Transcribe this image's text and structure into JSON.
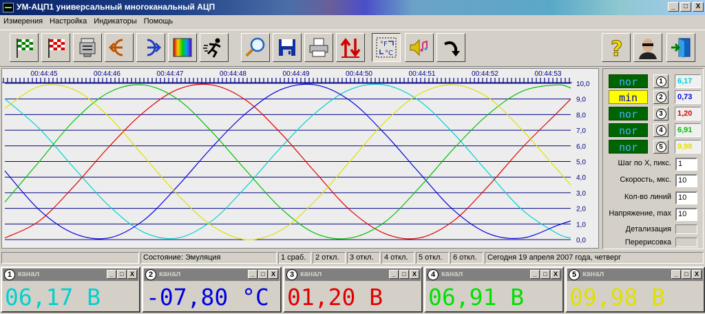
{
  "window": {
    "title": "УМ-АЦП1 универсальный многоканальный АЦП",
    "min_label": "_",
    "max_label": "□",
    "close_label": "X"
  },
  "menu": [
    "Измерения",
    "Настройка",
    "Индикаторы",
    "Помощь"
  ],
  "toolbar": {
    "icons": [
      "start-flag-icon",
      "stop-flag-icon",
      "device-icon",
      "input-icon",
      "output-icon",
      "spectrum-icon",
      "runner-icon",
      "magnifier-icon",
      "save-icon",
      "printer-icon",
      "sort-arrows-icon",
      "units-convert-icon",
      "sound-icon",
      "undo-arrow-icon",
      "help-icon",
      "user-icon",
      "exit-icon"
    ]
  },
  "chart_data": {
    "type": "line",
    "title": "",
    "xlabel": "",
    "ylabel": "",
    "x_ticks": [
      "00:44:45",
      "00:44:46",
      "00:44:47",
      "00:44:48",
      "00:44:49",
      "00:44:50",
      "00:44:51",
      "00:44:52",
      "00:44:53"
    ],
    "y_ticks": [
      "10,0",
      "9,0",
      "8,0",
      "7,0",
      "6,0",
      "5,0",
      "4,0",
      "3,0",
      "2,0",
      "1,0",
      "0,0"
    ],
    "ylim": [
      0,
      10
    ],
    "grid": true,
    "series": [
      {
        "color": "#00d0d0",
        "x": [
          0,
          0.5,
          1,
          1.5,
          2,
          2.5,
          3,
          3.5,
          4,
          4.5,
          5,
          5.5,
          6,
          6.5,
          7,
          7.5,
          8,
          8.2
        ],
        "values": [
          9.0,
          7.1,
          4.6,
          2.2,
          0.5,
          0.1,
          1.2,
          3.4,
          5.9,
          8.1,
          9.6,
          9.9,
          8.9,
          6.8,
          4.3,
          1.9,
          0.4,
          0.1
        ]
      },
      {
        "color": "#0000e0",
        "x": [
          0,
          0.5,
          1,
          1.5,
          2,
          2.5,
          3,
          3.5,
          4,
          4.5,
          5,
          5.5,
          6,
          6.5,
          7,
          7.5,
          8,
          8.2
        ],
        "values": [
          4.4,
          1.9,
          0.4,
          0.1,
          1.2,
          3.4,
          5.9,
          8.1,
          9.6,
          9.9,
          8.9,
          6.8,
          4.3,
          1.9,
          0.4,
          0.1,
          0.9,
          1.2
        ]
      },
      {
        "color": "#e00000",
        "x": [
          0,
          0.5,
          1,
          1.5,
          2,
          2.5,
          3,
          3.5,
          4,
          4.5,
          5,
          5.5,
          6,
          6.5,
          7,
          7.5,
          8,
          8.2
        ],
        "values": [
          0.1,
          1.2,
          3.4,
          5.9,
          8.1,
          9.6,
          9.9,
          8.9,
          6.8,
          4.3,
          1.9,
          0.4,
          0.1,
          1.2,
          3.4,
          5.9,
          8.1,
          9.0
        ]
      },
      {
        "color": "#00c000",
        "x": [
          0,
          0.5,
          1,
          1.5,
          2,
          2.5,
          3,
          3.5,
          4,
          4.5,
          5,
          5.5,
          6,
          6.5,
          7,
          7.5,
          8,
          8.2
        ],
        "values": [
          2.4,
          5.0,
          7.6,
          9.4,
          9.9,
          9.0,
          6.9,
          4.4,
          2.0,
          0.4,
          0.1,
          1.1,
          3.3,
          5.8,
          8.0,
          9.5,
          9.9,
          9.7
        ]
      },
      {
        "color": "#e0e000",
        "x": [
          0,
          0.5,
          1,
          1.5,
          2,
          2.5,
          3,
          3.5,
          4,
          4.5,
          5,
          5.5,
          6,
          6.5,
          7,
          7.5,
          8,
          8.2
        ],
        "values": [
          8.4,
          9.8,
          9.6,
          7.9,
          5.4,
          2.9,
          0.9,
          0.0,
          0.6,
          2.5,
          5.0,
          7.5,
          9.3,
          9.9,
          9.1,
          7.0,
          4.5,
          3.5
        ]
      }
    ]
  },
  "channels": [
    {
      "num": "1",
      "mode": "nor",
      "mode_type": "nor",
      "value": "6,17",
      "color": "#00d0d0"
    },
    {
      "num": "2",
      "mode": "min",
      "mode_type": "min",
      "value": "0,73",
      "color": "#0000e0"
    },
    {
      "num": "3",
      "mode": "nor",
      "mode_type": "nor",
      "value": "1,20",
      "color": "#e00000"
    },
    {
      "num": "4",
      "mode": "nor",
      "mode_type": "nor",
      "value": "6,91",
      "color": "#00c000"
    },
    {
      "num": "5",
      "mode": "nor",
      "mode_type": "nor",
      "value": "9,98",
      "color": "#e0e000"
    }
  ],
  "params": {
    "step_x_label": "Шаг по X, пикс.",
    "step_x_value": "1",
    "speed_label": "Скорость, мкс.",
    "speed_value": "10",
    "lines_label": "Кол-во линий",
    "lines_value": "10",
    "voltage_label": "Напряжение, max",
    "voltage_value": "10",
    "detail_label": "Детализация",
    "redraw_label": "Перерисовка"
  },
  "status": {
    "state": "Состояние: Эмуляция",
    "cells": [
      "1 сраб.",
      "2 откл.",
      "3 откл.",
      "4 откл.",
      "5 откл.",
      "6 откл."
    ],
    "date": "Сегодня 19 апреля 2007 года, четверг"
  },
  "indicators": [
    {
      "num": "1",
      "label": "канал",
      "value": "06,17 В",
      "color": "#00d0d0"
    },
    {
      "num": "2",
      "label": "канал",
      "value": "-07,80 °С",
      "color": "#0000e0"
    },
    {
      "num": "3",
      "label": "канал",
      "value": "01,20 В",
      "color": "#e00000"
    },
    {
      "num": "4",
      "label": "канал",
      "value": "06,91 В",
      "color": "#00e000"
    },
    {
      "num": "5",
      "label": "канал",
      "value": "09,98 В",
      "color": "#e0e000"
    }
  ]
}
